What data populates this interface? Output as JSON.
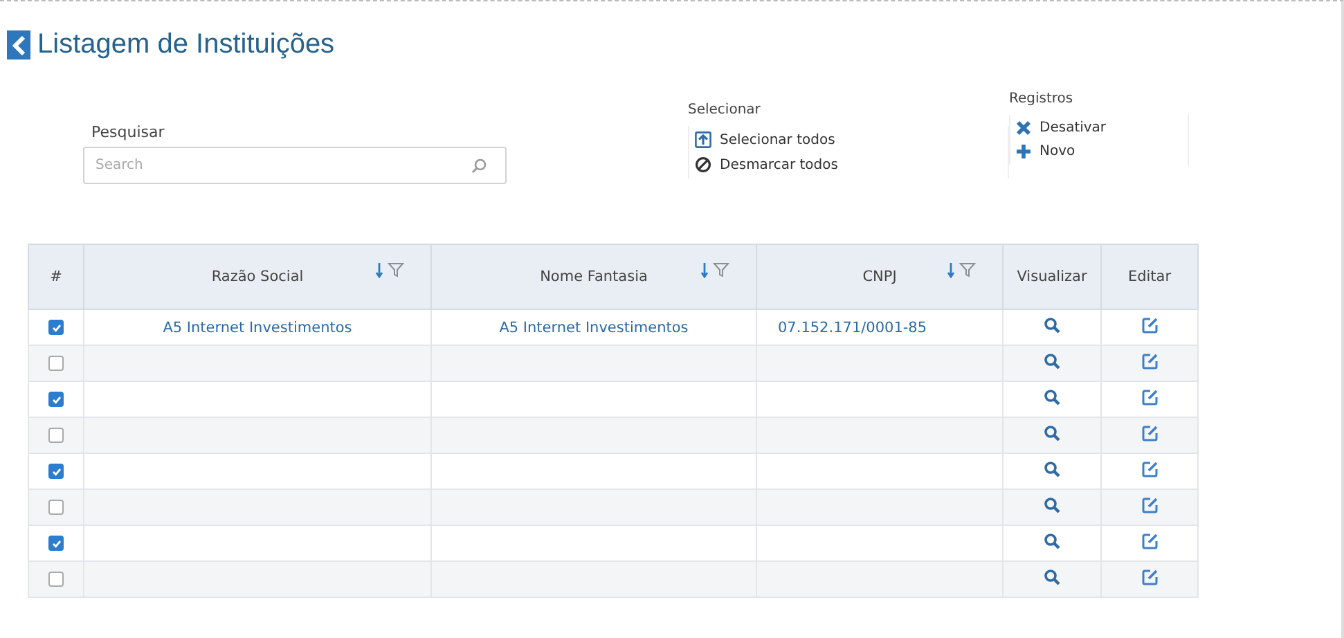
{
  "page": {
    "title": "Listagem de Instituições"
  },
  "search": {
    "label": "Pesquisar",
    "placeholder": "Search"
  },
  "select_group": {
    "title": "Selecionar",
    "actions": [
      {
        "kind": "select",
        "label": "Selecionar todos"
      },
      {
        "kind": "clear",
        "label": "Desmarcar todos"
      }
    ]
  },
  "records_group": {
    "title": "Registros",
    "actions": [
      {
        "kind": "deactivate",
        "label": "Desativar"
      },
      {
        "kind": "new",
        "label": "Novo"
      }
    ]
  },
  "table": {
    "columns": [
      {
        "label": "#",
        "kind": "plain"
      },
      {
        "label": "Razão Social",
        "kind": "sortable"
      },
      {
        "label": "Nome Fantasia",
        "kind": "sortable"
      },
      {
        "label": "CNPJ",
        "kind": "sortable"
      },
      {
        "label": "Visualizar",
        "kind": "plain"
      },
      {
        "label": "Editar",
        "kind": "plain"
      }
    ],
    "rows": [
      {
        "checked": true,
        "razao_social": "A5 Internet Investimentos",
        "nome_fantasia": "A5 Internet Investimentos",
        "cnpj": "07.152.171/0001-85"
      },
      {
        "checked": false
      },
      {
        "checked": true
      },
      {
        "checked": false
      },
      {
        "checked": true
      },
      {
        "checked": false
      },
      {
        "checked": true
      },
      {
        "checked": false
      }
    ]
  }
}
